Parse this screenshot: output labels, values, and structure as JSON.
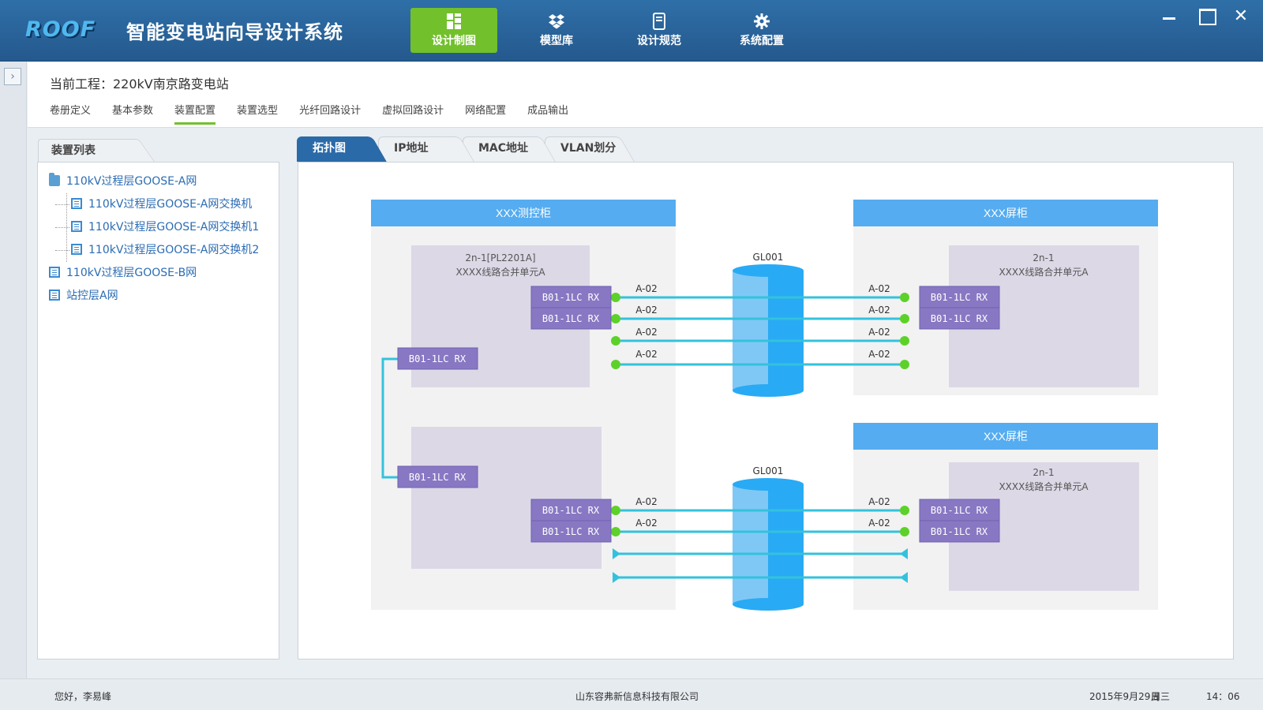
{
  "app": {
    "logo": "ROOF",
    "title": "智能变电站向导设计系统"
  },
  "topnav": [
    {
      "label": "设计制图",
      "icon": "drawing-icon",
      "active": true
    },
    {
      "label": "模型库",
      "icon": "dropbox-icon",
      "active": false
    },
    {
      "label": "设计规范",
      "icon": "book-icon",
      "active": false
    },
    {
      "label": "系统配置",
      "icon": "gear-icon",
      "active": false
    }
  ],
  "window_controls": {
    "close": "✕"
  },
  "project": {
    "title": "当前工程：220kV南京路变电站"
  },
  "subtabs": [
    {
      "label": "卷册定义",
      "active": false
    },
    {
      "label": "基本参数",
      "active": false
    },
    {
      "label": "装置配置",
      "active": true
    },
    {
      "label": "装置选型",
      "active": false
    },
    {
      "label": "光纤回路设计",
      "active": false
    },
    {
      "label": "虚拟回路设计",
      "active": false
    },
    {
      "label": "网络配置",
      "active": false
    },
    {
      "label": "成品输出",
      "active": false
    }
  ],
  "device_list": {
    "title": "装置列表",
    "items": [
      {
        "label": "110kV过程层GOOSE-A网",
        "icon": "folder-icon",
        "level": 0
      },
      {
        "label": "110kV过程层GOOSE-A网交换机",
        "icon": "document-icon",
        "level": 1
      },
      {
        "label": "110kV过程层GOOSE-A网交换机1",
        "icon": "document-icon",
        "level": 1
      },
      {
        "label": "110kV过程层GOOSE-A网交换机2",
        "icon": "document-icon",
        "level": 1
      },
      {
        "label": "110kV过程层GOOSE-B网",
        "icon": "document-icon",
        "level": 0
      },
      {
        "label": "站控层A网",
        "icon": "document-icon",
        "level": 0
      }
    ]
  },
  "view_tabs": [
    {
      "label": "拓扑图",
      "active": true
    },
    {
      "label": "IP地址",
      "active": false
    },
    {
      "label": "MAC地址",
      "active": false
    },
    {
      "label": "VLAN划分",
      "active": false
    }
  ],
  "topology": {
    "left_cabinet": {
      "title": "XXX测控柜",
      "unit_name": "2n-1[PL2201A]",
      "unit_desc": "XXXX线路合并单元A"
    },
    "right_cabinet_top": {
      "title": "XXX屏柜",
      "unit_name": "2n-1",
      "unit_desc": "XXXX线路合并单元A"
    },
    "right_cabinet_bottom": {
      "title": "XXX屏柜",
      "unit_name": "2n-1",
      "unit_desc": "XXXX线路合并单元A"
    },
    "cable_top": "GL001",
    "cable_bottom": "GL001",
    "port_label": "B01-1LC   RX",
    "link_label": "A-02"
  },
  "colors": {
    "accent_green": "#72c02c",
    "header_blue": "#2a6aa8",
    "cabinet_header": "#55acf0",
    "port_purple": "#8878c3",
    "link_cyan": "#33c2dd",
    "cable_blue": "#29aaf4"
  },
  "status": {
    "user": "您好，李易峰",
    "company": "山东容弗新信息科技有限公司",
    "date": "2015年9月29日",
    "weekday": "周三",
    "time": "14：06"
  }
}
